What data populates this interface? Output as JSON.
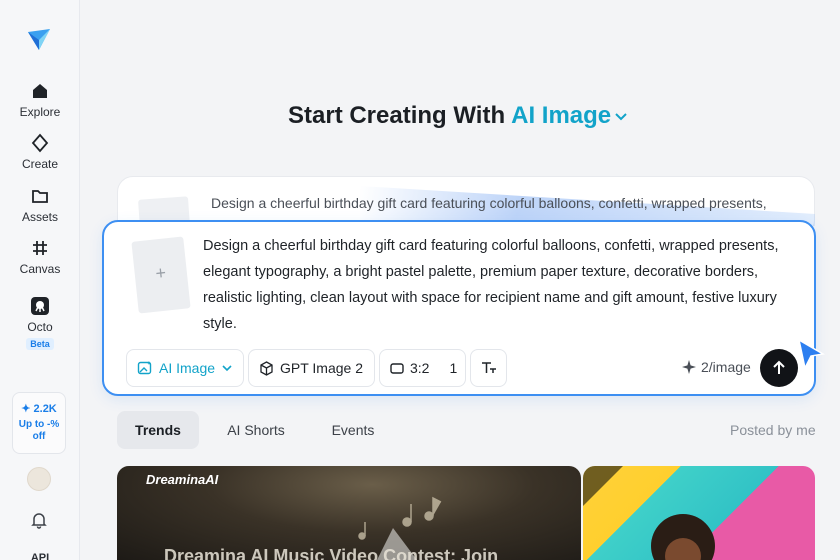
{
  "sidebar": {
    "items": [
      {
        "label": "Explore",
        "icon": "home-icon"
      },
      {
        "label": "Create",
        "icon": "sparkle-diamond-icon"
      },
      {
        "label": "Assets",
        "icon": "folder-icon"
      },
      {
        "label": "Canvas",
        "icon": "hashtag-canvas-icon"
      },
      {
        "label": "Octo",
        "icon": "octo-icon",
        "badge": "Beta"
      }
    ],
    "credits": {
      "count": "2.2K",
      "promo": "Up to -% off"
    },
    "bottom_label": "API"
  },
  "header": {
    "prefix": "Start Creating With",
    "mode": "AI Image"
  },
  "prompt": {
    "ghost_text": "Design a cheerful birthday gift card featuring colorful balloons, confetti, wrapped presents,",
    "text": "Design a cheerful birthday gift card featuring colorful balloons, confetti, wrapped presents, elegant typography, a bright pastel palette, premium paper texture, decorative borders, realistic lighting, clean layout with space for recipient name and gift amount, festive luxury style.",
    "add_symbol": "+"
  },
  "toolbar": {
    "mode_label": "AI Image",
    "model_label": "GPT Image 2",
    "ratio_label": "3:2",
    "count_label": "1",
    "cost_label": "2/image"
  },
  "tabs": [
    {
      "label": "Trends",
      "active": true
    },
    {
      "label": "AI Shorts",
      "active": false
    },
    {
      "label": "Events",
      "active": false
    }
  ],
  "posted_filter": "Posted by me",
  "gallery": {
    "brand": "DreaminaAI",
    "caption": "Dreamina AI Music Video Contest: Join"
  },
  "colors": {
    "accent": "#12a3c9",
    "focus_border": "#3d8ff2",
    "send": "#111317"
  }
}
